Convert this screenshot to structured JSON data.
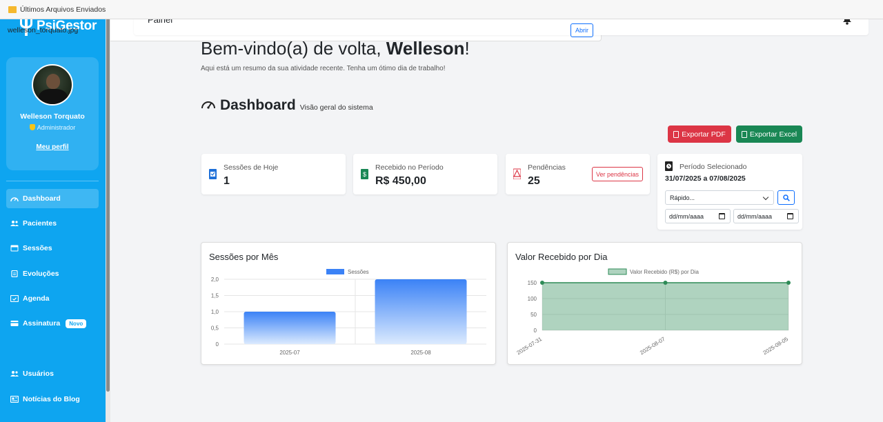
{
  "sidebar": {
    "brand": "PsiGestor",
    "profile": {
      "name": "Welleson Torquato",
      "role": "Administrador",
      "link": "Meu perfil"
    },
    "items": [
      {
        "label": "Dashboard",
        "icon": "gauge-icon"
      },
      {
        "label": "Pacientes",
        "icon": "users-icon"
      },
      {
        "label": "Sessões",
        "icon": "calendar-icon"
      },
      {
        "label": "Evoluções",
        "icon": "clipboard-icon"
      },
      {
        "label": "Agenda",
        "icon": "calendar-check-icon"
      },
      {
        "label": "Assinatura",
        "icon": "card-icon",
        "badge": "Novo"
      },
      {
        "label": "Usuários",
        "icon": "users-icon"
      },
      {
        "label": "Notícias do Blog",
        "icon": "newspaper-icon"
      }
    ]
  },
  "topbar": {
    "title": "Painel"
  },
  "welcome": {
    "prefix": "Bem-vindo(a) de volta,",
    "name": "Welleson",
    "suffix": "!",
    "subtitle": "Aqui está um resumo da sua atividade recente. Tenha um ótimo dia de trabalho!"
  },
  "dashboard": {
    "title": "Dashboard",
    "subtitle": "Visão geral do sistema"
  },
  "actions": {
    "export_pdf": "Exportar PDF",
    "export_excel": "Exportar Excel"
  },
  "stats": {
    "sessions_today": {
      "label": "Sessões de Hoje",
      "value": "1"
    },
    "received": {
      "label": "Recebido no Período",
      "value": "R$ 450,00"
    },
    "pending": {
      "label": "Pendências",
      "value": "25",
      "button": "Ver pendências"
    }
  },
  "period": {
    "label": "Período Selecionado",
    "range": "31/07/2025 a 07/08/2025",
    "quick_select": "Rápido...",
    "date_start_placeholder": "dd/mm/aaaa",
    "date_end_placeholder": "dd/mm/aaaa"
  },
  "colors": {
    "sidebar": "#0ea5f0",
    "bar": "#3b82f6",
    "line": "#2e8b57",
    "danger": "#dc3545",
    "success": "#198754"
  },
  "chart_data": [
    {
      "type": "bar",
      "title": "Sessões por Mês",
      "categories": [
        "2025-07",
        "2025-08"
      ],
      "series": [
        {
          "name": "Sessões",
          "values": [
            1,
            2
          ]
        }
      ],
      "yticks": [
        "0",
        "0,5",
        "1,0",
        "1,5",
        "2,0"
      ],
      "ylim": [
        0,
        2
      ],
      "grid": true,
      "legend": "top"
    },
    {
      "type": "area",
      "title": "Valor Recebido por Dia",
      "categories": [
        "2025-07-31",
        "2025-08-07",
        "2025-08-05"
      ],
      "series": [
        {
          "name": "Valor Recebido (R$) por Dia",
          "values": [
            150,
            150,
            150
          ]
        }
      ],
      "yticks": [
        "0",
        "50",
        "100",
        "150"
      ],
      "ylim": [
        0,
        150
      ],
      "grid": true,
      "legend": "top"
    }
  ],
  "files": {
    "title": "Últimos Arquivos Enviados",
    "items": [
      {
        "name": "welleson_torquato.jpg",
        "action": "Abrir"
      }
    ]
  }
}
